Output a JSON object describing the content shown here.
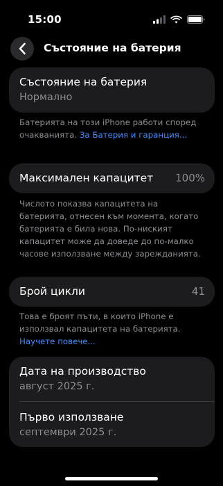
{
  "status_bar": {
    "time": "15:00"
  },
  "nav": {
    "title": "Състояние на батерия"
  },
  "health_card": {
    "title": "Състояние на батерия",
    "value": "Нормално"
  },
  "health_note": {
    "text": "Батерията на този iPhone работи според очакванията. ",
    "link": "За Батерия и гаранция..."
  },
  "capacity_card": {
    "title": "Максимален капацитет",
    "value": "100%"
  },
  "capacity_note": {
    "text": "Числото показва капацитета на батерията, отнесен към момента, когато батерията е била нова. По-ниският капацитет може да доведе до по-малко часове използване между зарежданията."
  },
  "cycles_card": {
    "title": "Брой цикли",
    "value": "41"
  },
  "cycles_note": {
    "text": "Това е броят пъти, в които iPhone е използвал капацитета на батерията. ",
    "link": "Научете повече..."
  },
  "dates_card": {
    "manufacture_label": "Дата на производство",
    "manufacture_value": "август 2025 г.",
    "first_use_label": "Първо използване",
    "first_use_value": "септември 2025 г."
  },
  "colors": {
    "background": "#000000",
    "card": "#1c1c1e",
    "secondary_text": "#8e8e93",
    "link": "#3d8dff"
  },
  "icons": {
    "signal": "signal-icon",
    "wifi": "wifi-icon",
    "battery": "battery-icon",
    "back": "chevron-left-icon"
  }
}
